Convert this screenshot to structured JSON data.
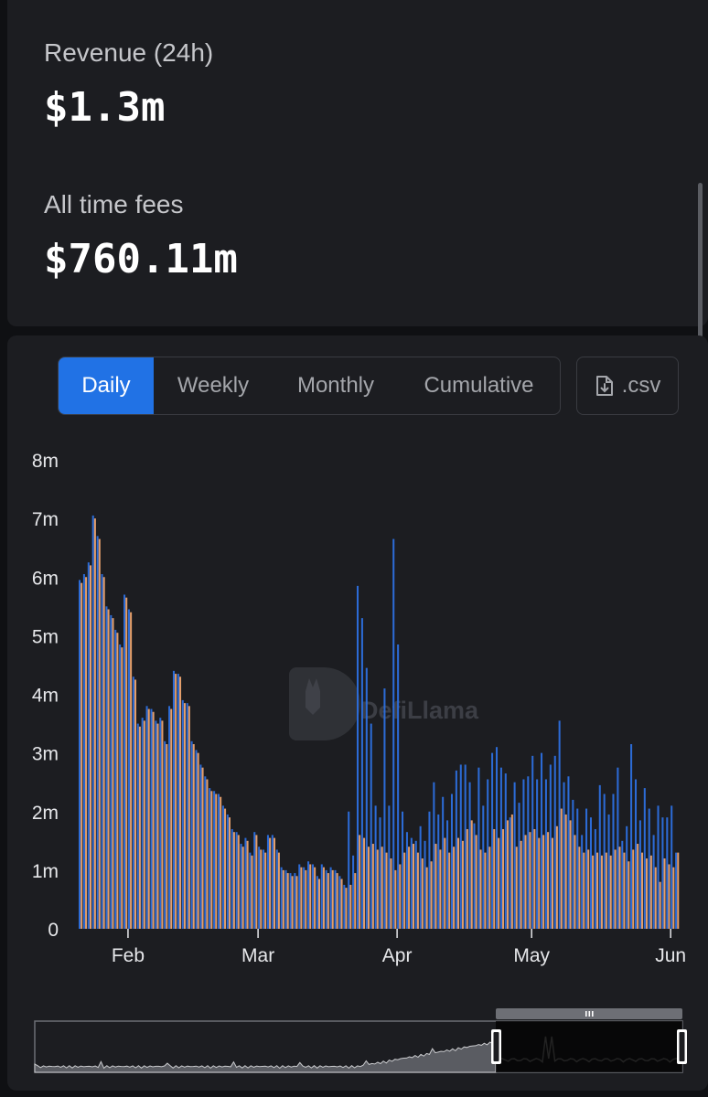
{
  "stats": {
    "revenue_label": "Revenue (24h)",
    "revenue_value": "$1.3m",
    "fees_label": "All time fees",
    "fees_value": "$760.11m"
  },
  "controls": {
    "tabs": [
      "Daily",
      "Weekly",
      "Monthly",
      "Cumulative"
    ],
    "active_tab": "Daily",
    "csv_label": ".csv"
  },
  "watermark": "DefiLlama",
  "colors": {
    "fees_bar": "#2c6bd6",
    "revenue_bar": "#e39e6b",
    "accent": "#2172e5",
    "card": "#1c1d21"
  },
  "chart_data": {
    "type": "bar",
    "title": "",
    "xlabel": "",
    "ylabel": "",
    "ylim": [
      0,
      8000000
    ],
    "y_ticks": [
      "0",
      "1m",
      "2m",
      "3m",
      "4m",
      "5m",
      "6m",
      "7m",
      "8m"
    ],
    "x_ticks": [
      "Feb",
      "Mar",
      "Apr",
      "May",
      "Jun"
    ],
    "x_tick_dates": [
      "2024-02-01",
      "2024-03-01",
      "2024-04-01",
      "2024-05-01",
      "2024-06-01"
    ],
    "x_start": "2024-01-21",
    "series": [
      {
        "color": "#2c6bd6",
        "values": [
          5.95,
          6.05,
          6.25,
          7.05,
          6.7,
          6.05,
          5.5,
          5.35,
          5.1,
          4.85,
          5.7,
          5.45,
          4.3,
          3.5,
          3.6,
          3.8,
          3.75,
          3.55,
          3.6,
          3.2,
          3.8,
          4.4,
          4.35,
          3.9,
          3.85,
          3.2,
          3.05,
          2.8,
          2.6,
          2.4,
          2.35,
          2.3,
          2.1,
          1.95,
          1.7,
          1.65,
          1.45,
          1.55,
          1.3,
          1.65,
          1.4,
          1.35,
          1.6,
          1.6,
          1.35,
          1.05,
          1.0,
          0.95,
          0.95,
          1.1,
          1.05,
          1.15,
          1.1,
          0.9,
          1.1,
          1.0,
          1.05,
          1.0,
          0.9,
          0.75,
          2.0,
          1.25,
          5.85,
          5.3,
          4.45,
          3.5,
          2.1,
          1.9,
          4.1,
          2.1,
          6.65,
          4.85,
          2.0,
          1.65,
          1.55,
          1.5,
          1.75,
          1.5,
          2.0,
          2.5,
          1.95,
          2.25,
          1.85,
          2.3,
          2.7,
          2.8,
          2.8,
          2.5,
          1.8,
          2.75,
          2.1,
          2.55,
          3.0,
          3.1,
          2.75,
          2.65,
          1.9,
          2.5,
          2.15,
          2.55,
          2.6,
          2.95,
          2.55,
          3.0,
          2.55,
          2.8,
          2.95,
          3.55,
          2.5,
          2.6,
          2.2,
          2.05,
          1.6,
          2.05,
          1.9,
          1.7,
          2.45,
          2.3,
          1.95,
          2.3,
          2.75,
          1.5,
          1.75,
          3.15,
          2.55,
          1.85,
          2.4,
          2.05,
          1.6,
          2.1,
          1.9,
          1.9,
          2.1,
          1.3
        ]
      },
      {
        "color": "#e39e6b",
        "values": [
          5.9,
          6.0,
          6.2,
          7.0,
          6.65,
          6.0,
          5.45,
          5.3,
          5.05,
          4.8,
          5.65,
          5.4,
          4.25,
          3.45,
          3.55,
          3.75,
          3.7,
          3.5,
          3.55,
          3.15,
          3.75,
          4.35,
          4.3,
          3.85,
          3.8,
          3.15,
          3.0,
          2.75,
          2.55,
          2.35,
          2.3,
          2.25,
          2.05,
          1.9,
          1.65,
          1.6,
          1.4,
          1.5,
          1.25,
          1.6,
          1.35,
          1.3,
          1.55,
          1.55,
          1.3,
          1.0,
          0.95,
          0.9,
          0.9,
          1.05,
          1.0,
          1.1,
          1.05,
          0.85,
          1.05,
          0.95,
          1.0,
          0.95,
          0.85,
          0.7,
          0.75,
          0.95,
          1.6,
          1.55,
          1.4,
          1.45,
          1.35,
          1.4,
          1.3,
          1.2,
          1.0,
          1.1,
          1.3,
          1.4,
          1.45,
          1.3,
          1.2,
          1.05,
          1.15,
          1.45,
          1.35,
          1.55,
          1.3,
          1.4,
          1.55,
          1.5,
          1.7,
          1.85,
          1.6,
          1.35,
          1.3,
          1.4,
          1.7,
          1.55,
          1.7,
          1.85,
          1.95,
          1.4,
          1.5,
          1.6,
          1.65,
          1.7,
          1.55,
          1.6,
          1.65,
          1.55,
          1.75,
          2.05,
          1.95,
          1.85,
          1.6,
          1.4,
          1.3,
          1.35,
          1.25,
          1.3,
          1.25,
          1.3,
          1.25,
          1.35,
          1.4,
          1.3,
          1.15,
          1.35,
          1.45,
          1.3,
          1.2,
          1.25,
          1.05,
          0.8,
          1.2,
          1.1,
          1.05,
          1.3
        ]
      }
    ],
    "brush": {
      "window_start_fraction": 0.7,
      "window_end_fraction": 1.0
    }
  }
}
